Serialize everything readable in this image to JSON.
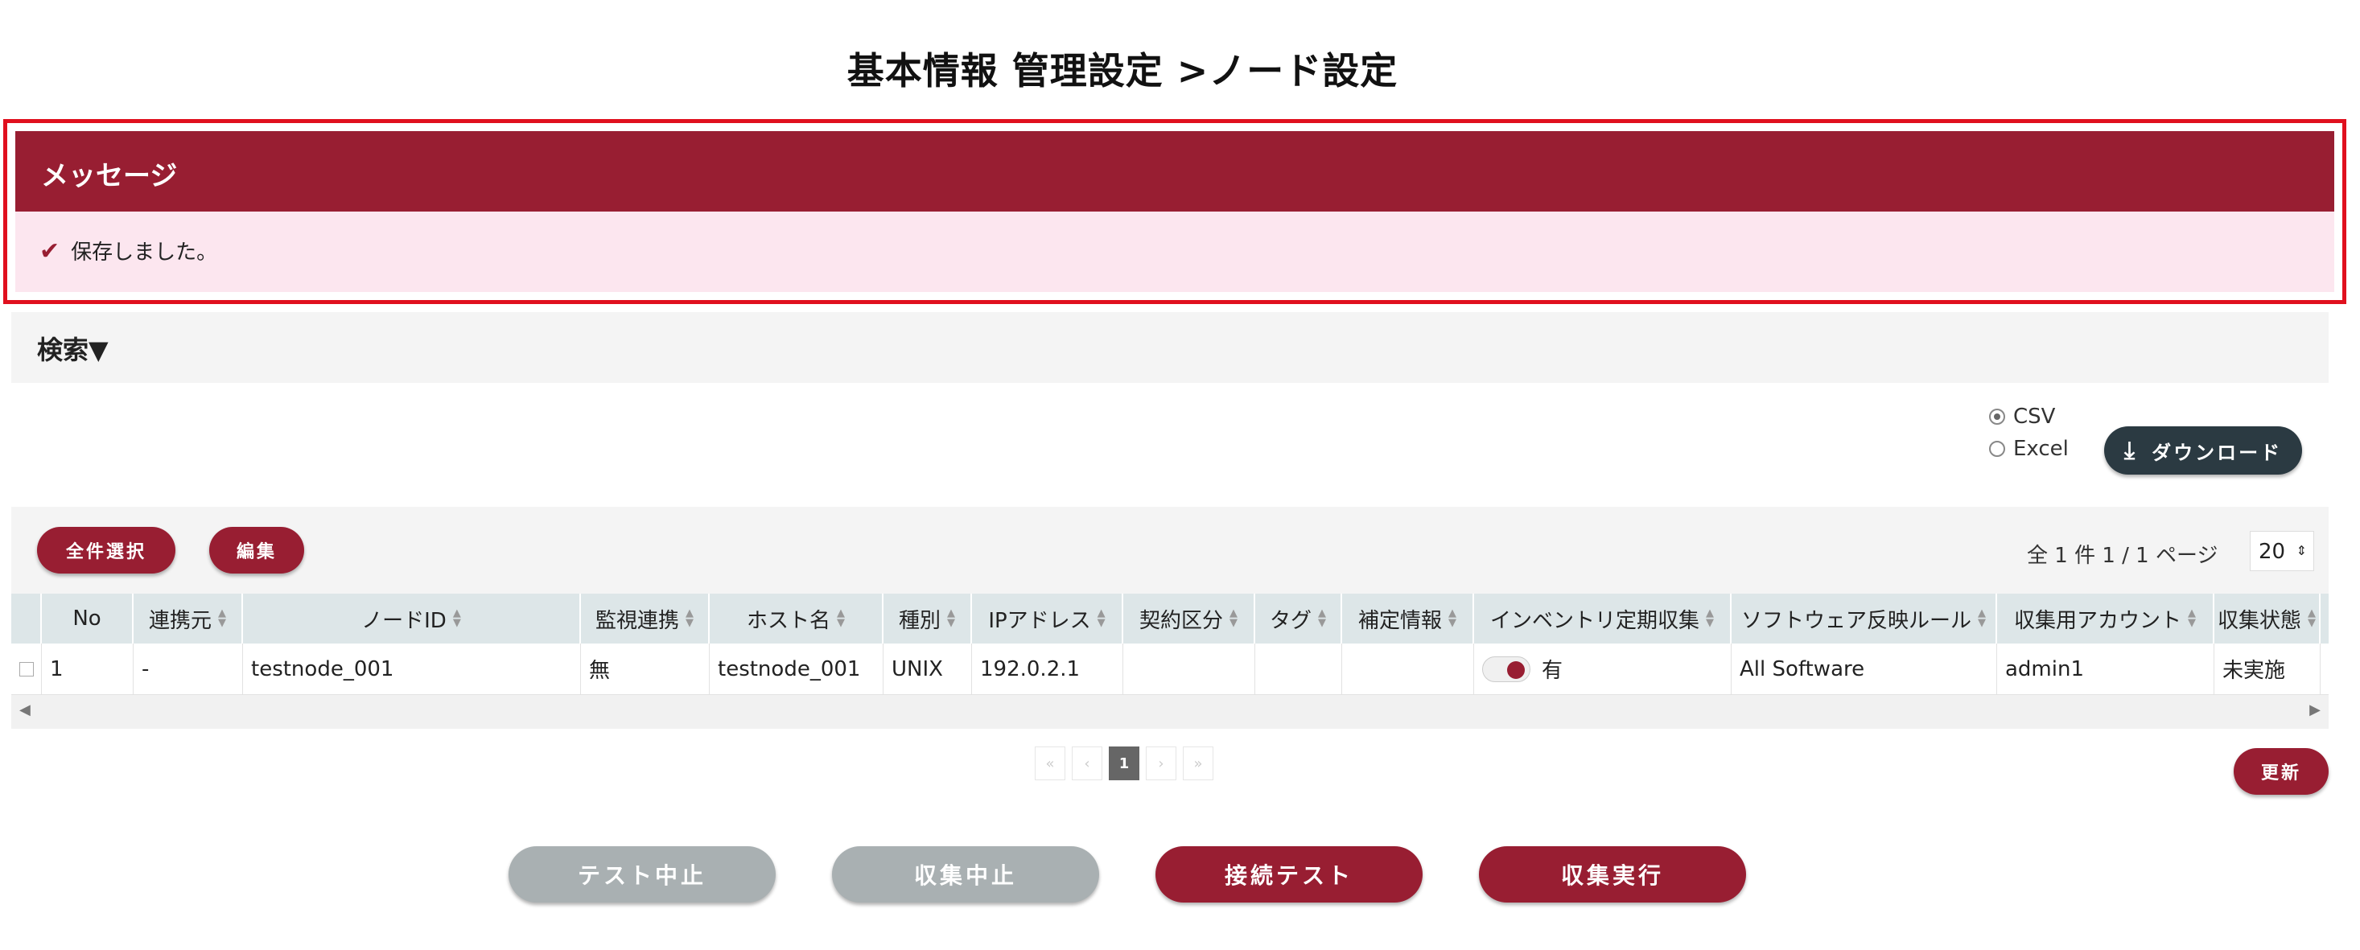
{
  "page": {
    "title": "基本情報 管理設定 >ノード設定"
  },
  "message": {
    "header": "メッセージ",
    "text": "保存しました。",
    "check_icon": "✔"
  },
  "search": {
    "label": "検索▼"
  },
  "export": {
    "options": [
      {
        "label": "CSV",
        "selected": true
      },
      {
        "label": "Excel",
        "selected": false
      }
    ],
    "download_label": "ダウンロード",
    "download_icon": "⤓"
  },
  "toolbar": {
    "select_all_label": "全件選択",
    "edit_label": "編集",
    "count_text": "全 1 件 1 / 1 ページ",
    "page_size": "20"
  },
  "table": {
    "columns": [
      "",
      "No",
      "連携元",
      "ノードID",
      "監視連携",
      "ホスト名",
      "種別",
      "IPアドレス",
      "契約区分",
      "タグ",
      "補定情報",
      "インベントリ定期収集",
      "ソフトウェア反映ルール",
      "収集用アカウント",
      "収集状態"
    ],
    "rows": [
      {
        "no": "1",
        "source": "-",
        "node_id": "testnode_001",
        "monitor": "無",
        "host": "testnode_001",
        "type": "UNIX",
        "ip": "192.0.2.1",
        "contract": "",
        "tag": "",
        "info": "",
        "inventory_on": true,
        "inventory_label": "有",
        "rule": "All Software",
        "account": "admin1",
        "status": "未実施"
      }
    ]
  },
  "pagination": {
    "first": "«",
    "prev": "‹",
    "current": "1",
    "next": "›",
    "last": "»"
  },
  "refresh_label": "更新",
  "actions": {
    "stop_test": "テスト中止",
    "stop_collect": "収集中止",
    "connect_test": "接続テスト",
    "run_collect": "収集実行"
  },
  "colors": {
    "brand": "#981e32",
    "alert_border": "#e0101e",
    "message_bg": "#fce6ef",
    "disabled": "#a9b0b2"
  }
}
